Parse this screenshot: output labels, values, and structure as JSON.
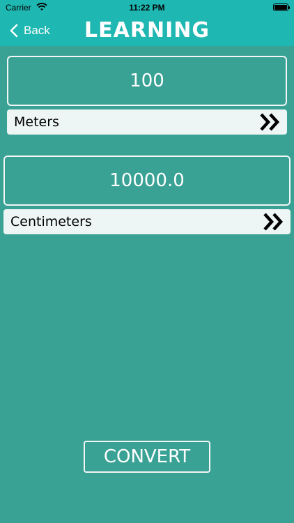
{
  "status": {
    "carrier": "Carrier",
    "time": "11:22 PM"
  },
  "nav": {
    "back_label": "Back",
    "title": "LEARNING"
  },
  "input": {
    "value": "100",
    "unit": "Meters"
  },
  "output": {
    "value": "10000.0",
    "unit": "Centimeters"
  },
  "convert_label": "CONVERT",
  "colors": {
    "background": "#3aa295",
    "bar": "#1fb7b1",
    "unit_bg": "#eef5f5"
  }
}
